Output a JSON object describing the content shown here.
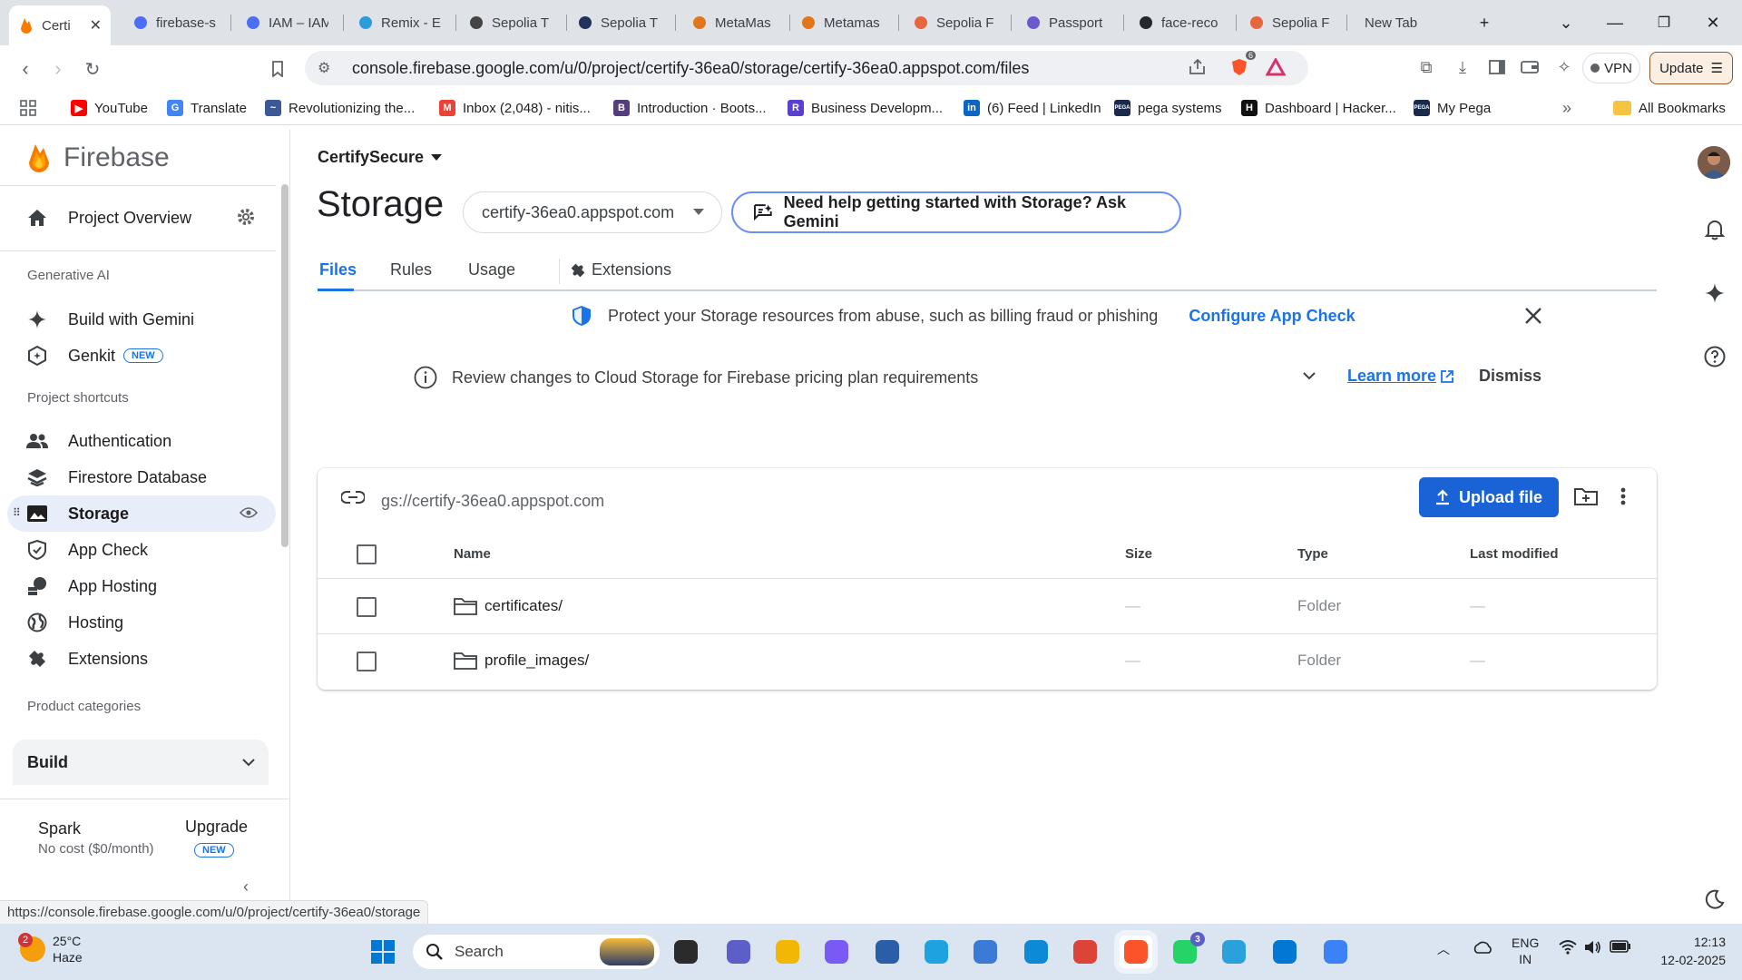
{
  "browser": {
    "tabs": [
      {
        "title": "Certi",
        "fav": "firebase-flame-icon",
        "color": "#f57c00"
      },
      {
        "title": "firebase-s",
        "fav": "shield-icon",
        "color": "#4c6ef5"
      },
      {
        "title": "IAM – IAM",
        "fav": "shield-icon",
        "color": "#4c6ef5"
      },
      {
        "title": "Remix - E",
        "fav": "remix-icon",
        "color": "#2d9cdb"
      },
      {
        "title": "Sepolia T",
        "fav": "etherscan-icon",
        "color": "#444"
      },
      {
        "title": "Sepolia T",
        "fav": "etherscan-icon",
        "color": "#21325b"
      },
      {
        "title": "MetaMas",
        "fav": "metamask-icon",
        "color": "#e2761b"
      },
      {
        "title": "Metamas",
        "fav": "metamask-icon",
        "color": "#e2761b"
      },
      {
        "title": "Sepolia F",
        "fav": "drop-icon",
        "color": "#e8663d"
      },
      {
        "title": "Passport",
        "fav": "passport-icon",
        "color": "#6a5acd"
      },
      {
        "title": "face-reco",
        "fav": "github-icon",
        "color": "#24292f"
      },
      {
        "title": "Sepolia F",
        "fav": "drop-icon",
        "color": "#e8663d"
      },
      {
        "title": "New Tab",
        "fav": "",
        "color": "#5f6368"
      }
    ],
    "url": "console.firebase.google.com/u/0/project/certify-36ea0/storage/certify-36ea0.appspot.com/files",
    "vpn_label": "VPN",
    "update_label": "Update",
    "brave_badge": "6",
    "bookmarks": [
      {
        "label": "YouTube",
        "color": "#ff0000",
        "glyph": "▶"
      },
      {
        "label": "Translate",
        "color": "#4285f4",
        "glyph": "G"
      },
      {
        "label": "Revolutionizing the...",
        "color": "#3b5998",
        "glyph": "~"
      },
      {
        "label": "Inbox (2,048) - nitis...",
        "color": "#ea4335",
        "glyph": "M"
      },
      {
        "label": "Introduction · Boots...",
        "color": "#563d7c",
        "glyph": "B"
      },
      {
        "label": "Business Developm...",
        "color": "#5b3fd1",
        "glyph": "R"
      },
      {
        "label": "(6) Feed | LinkedIn",
        "color": "#0a66c2",
        "glyph": "in"
      },
      {
        "label": "pega systems",
        "color": "#1b2a4a",
        "glyph": "PEGA"
      },
      {
        "label": "Dashboard | Hacker...",
        "color": "#111",
        "glyph": "H"
      },
      {
        "label": "My Pega",
        "color": "#1b2a4a",
        "glyph": "PEGA"
      }
    ],
    "all_bookmarks": "All Bookmarks",
    "status_url": "https://console.firebase.google.com/u/0/project/certify-36ea0/storage"
  },
  "sidebar": {
    "brand": "Firebase",
    "project_overview": "Project Overview",
    "section_genai": "Generative AI",
    "build_with_gemini": "Build with Gemini",
    "genkit": "Genkit",
    "new_badge": "NEW",
    "section_shortcuts": "Project shortcuts",
    "shortcuts": [
      "Authentication",
      "Firestore Database",
      "Storage",
      "App Check",
      "App Hosting",
      "Hosting",
      "Extensions"
    ],
    "section_categories": "Product categories",
    "build": "Build",
    "plan_name": "Spark",
    "plan_cost": "No cost ($0/month)",
    "upgrade": "Upgrade"
  },
  "main": {
    "project": "CertifySecure",
    "title": "Storage",
    "bucket": "certify-36ea0.appspot.com",
    "gemini_help": "Need help getting started with Storage? Ask Gemini",
    "tabs": [
      "Files",
      "Rules",
      "Usage",
      "Extensions"
    ],
    "app_check_banner": "Protect your Storage resources from abuse, such as billing fraud or phishing",
    "configure_app_check": "Configure App Check",
    "pricing_banner": "Review changes to Cloud Storage for Firebase pricing plan requirements",
    "learn_more": "Learn more",
    "dismiss": "Dismiss",
    "gs_path": "gs://certify-36ea0.appspot.com",
    "upload_file": "Upload file",
    "columns": [
      "Name",
      "Size",
      "Type",
      "Last modified"
    ],
    "rows": [
      {
        "name": "certificates/",
        "size": "—",
        "type": "Folder",
        "modified": "—"
      },
      {
        "name": "profile_images/",
        "size": "—",
        "type": "Folder",
        "modified": "—"
      }
    ]
  },
  "taskbar": {
    "temp": "25°C",
    "weather": "Haze",
    "weather_badge": "2",
    "search": "Search",
    "whatsapp_badge": "3",
    "lang1": "ENG",
    "lang2": "IN",
    "time": "12:13",
    "date": "12-02-2025"
  },
  "colors": {
    "accent": "#1a73e8",
    "primary_button": "#1a63d6",
    "active_nav": "#e8eef9"
  }
}
